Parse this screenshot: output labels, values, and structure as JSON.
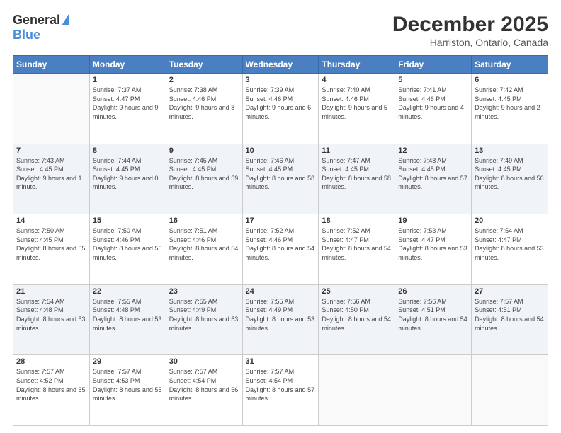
{
  "header": {
    "logo_general": "General",
    "logo_blue": "Blue",
    "title": "December 2025",
    "location": "Harriston, Ontario, Canada"
  },
  "weekdays": [
    "Sunday",
    "Monday",
    "Tuesday",
    "Wednesday",
    "Thursday",
    "Friday",
    "Saturday"
  ],
  "weeks": [
    [
      {
        "day": "",
        "sunrise": "",
        "sunset": "",
        "daylight": ""
      },
      {
        "day": "1",
        "sunrise": "Sunrise: 7:37 AM",
        "sunset": "Sunset: 4:47 PM",
        "daylight": "Daylight: 9 hours and 9 minutes."
      },
      {
        "day": "2",
        "sunrise": "Sunrise: 7:38 AM",
        "sunset": "Sunset: 4:46 PM",
        "daylight": "Daylight: 9 hours and 8 minutes."
      },
      {
        "day": "3",
        "sunrise": "Sunrise: 7:39 AM",
        "sunset": "Sunset: 4:46 PM",
        "daylight": "Daylight: 9 hours and 6 minutes."
      },
      {
        "day": "4",
        "sunrise": "Sunrise: 7:40 AM",
        "sunset": "Sunset: 4:46 PM",
        "daylight": "Daylight: 9 hours and 5 minutes."
      },
      {
        "day": "5",
        "sunrise": "Sunrise: 7:41 AM",
        "sunset": "Sunset: 4:46 PM",
        "daylight": "Daylight: 9 hours and 4 minutes."
      },
      {
        "day": "6",
        "sunrise": "Sunrise: 7:42 AM",
        "sunset": "Sunset: 4:45 PM",
        "daylight": "Daylight: 9 hours and 2 minutes."
      }
    ],
    [
      {
        "day": "7",
        "sunrise": "Sunrise: 7:43 AM",
        "sunset": "Sunset: 4:45 PM",
        "daylight": "Daylight: 9 hours and 1 minute."
      },
      {
        "day": "8",
        "sunrise": "Sunrise: 7:44 AM",
        "sunset": "Sunset: 4:45 PM",
        "daylight": "Daylight: 9 hours and 0 minutes."
      },
      {
        "day": "9",
        "sunrise": "Sunrise: 7:45 AM",
        "sunset": "Sunset: 4:45 PM",
        "daylight": "Daylight: 8 hours and 59 minutes."
      },
      {
        "day": "10",
        "sunrise": "Sunrise: 7:46 AM",
        "sunset": "Sunset: 4:45 PM",
        "daylight": "Daylight: 8 hours and 58 minutes."
      },
      {
        "day": "11",
        "sunrise": "Sunrise: 7:47 AM",
        "sunset": "Sunset: 4:45 PM",
        "daylight": "Daylight: 8 hours and 58 minutes."
      },
      {
        "day": "12",
        "sunrise": "Sunrise: 7:48 AM",
        "sunset": "Sunset: 4:45 PM",
        "daylight": "Daylight: 8 hours and 57 minutes."
      },
      {
        "day": "13",
        "sunrise": "Sunrise: 7:49 AM",
        "sunset": "Sunset: 4:45 PM",
        "daylight": "Daylight: 8 hours and 56 minutes."
      }
    ],
    [
      {
        "day": "14",
        "sunrise": "Sunrise: 7:50 AM",
        "sunset": "Sunset: 4:45 PM",
        "daylight": "Daylight: 8 hours and 55 minutes."
      },
      {
        "day": "15",
        "sunrise": "Sunrise: 7:50 AM",
        "sunset": "Sunset: 4:46 PM",
        "daylight": "Daylight: 8 hours and 55 minutes."
      },
      {
        "day": "16",
        "sunrise": "Sunrise: 7:51 AM",
        "sunset": "Sunset: 4:46 PM",
        "daylight": "Daylight: 8 hours and 54 minutes."
      },
      {
        "day": "17",
        "sunrise": "Sunrise: 7:52 AM",
        "sunset": "Sunset: 4:46 PM",
        "daylight": "Daylight: 8 hours and 54 minutes."
      },
      {
        "day": "18",
        "sunrise": "Sunrise: 7:52 AM",
        "sunset": "Sunset: 4:47 PM",
        "daylight": "Daylight: 8 hours and 54 minutes."
      },
      {
        "day": "19",
        "sunrise": "Sunrise: 7:53 AM",
        "sunset": "Sunset: 4:47 PM",
        "daylight": "Daylight: 8 hours and 53 minutes."
      },
      {
        "day": "20",
        "sunrise": "Sunrise: 7:54 AM",
        "sunset": "Sunset: 4:47 PM",
        "daylight": "Daylight: 8 hours and 53 minutes."
      }
    ],
    [
      {
        "day": "21",
        "sunrise": "Sunrise: 7:54 AM",
        "sunset": "Sunset: 4:48 PM",
        "daylight": "Daylight: 8 hours and 53 minutes."
      },
      {
        "day": "22",
        "sunrise": "Sunrise: 7:55 AM",
        "sunset": "Sunset: 4:48 PM",
        "daylight": "Daylight: 8 hours and 53 minutes."
      },
      {
        "day": "23",
        "sunrise": "Sunrise: 7:55 AM",
        "sunset": "Sunset: 4:49 PM",
        "daylight": "Daylight: 8 hours and 53 minutes."
      },
      {
        "day": "24",
        "sunrise": "Sunrise: 7:55 AM",
        "sunset": "Sunset: 4:49 PM",
        "daylight": "Daylight: 8 hours and 53 minutes."
      },
      {
        "day": "25",
        "sunrise": "Sunrise: 7:56 AM",
        "sunset": "Sunset: 4:50 PM",
        "daylight": "Daylight: 8 hours and 54 minutes."
      },
      {
        "day": "26",
        "sunrise": "Sunrise: 7:56 AM",
        "sunset": "Sunset: 4:51 PM",
        "daylight": "Daylight: 8 hours and 54 minutes."
      },
      {
        "day": "27",
        "sunrise": "Sunrise: 7:57 AM",
        "sunset": "Sunset: 4:51 PM",
        "daylight": "Daylight: 8 hours and 54 minutes."
      }
    ],
    [
      {
        "day": "28",
        "sunrise": "Sunrise: 7:57 AM",
        "sunset": "Sunset: 4:52 PM",
        "daylight": "Daylight: 8 hours and 55 minutes."
      },
      {
        "day": "29",
        "sunrise": "Sunrise: 7:57 AM",
        "sunset": "Sunset: 4:53 PM",
        "daylight": "Daylight: 8 hours and 55 minutes."
      },
      {
        "day": "30",
        "sunrise": "Sunrise: 7:57 AM",
        "sunset": "Sunset: 4:54 PM",
        "daylight": "Daylight: 8 hours and 56 minutes."
      },
      {
        "day": "31",
        "sunrise": "Sunrise: 7:57 AM",
        "sunset": "Sunset: 4:54 PM",
        "daylight": "Daylight: 8 hours and 57 minutes."
      },
      {
        "day": "",
        "sunrise": "",
        "sunset": "",
        "daylight": ""
      },
      {
        "day": "",
        "sunrise": "",
        "sunset": "",
        "daylight": ""
      },
      {
        "day": "",
        "sunrise": "",
        "sunset": "",
        "daylight": ""
      }
    ]
  ]
}
